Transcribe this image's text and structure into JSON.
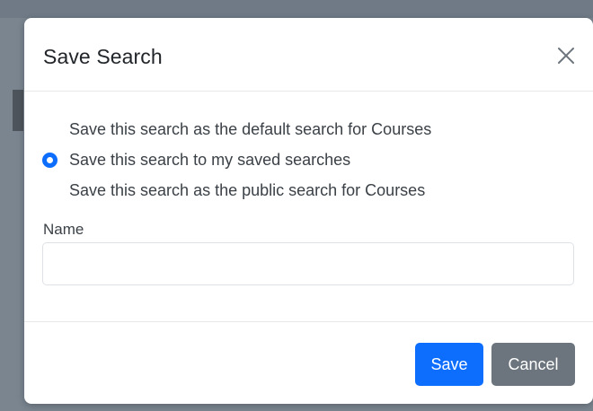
{
  "dialog": {
    "title": "Save Search",
    "close_icon": "close-icon"
  },
  "options": [
    {
      "label": "Save this search as the default search for Courses",
      "selected": false
    },
    {
      "label": "Save this search to my saved searches",
      "selected": true
    },
    {
      "label": "Save this search as the public search for Courses",
      "selected": false
    }
  ],
  "name_field": {
    "label": "Name",
    "value": "",
    "placeholder": ""
  },
  "footer": {
    "save_label": "Save",
    "cancel_label": "Cancel"
  },
  "colors": {
    "primary": "#0d6efd",
    "secondary": "#6c757d"
  }
}
